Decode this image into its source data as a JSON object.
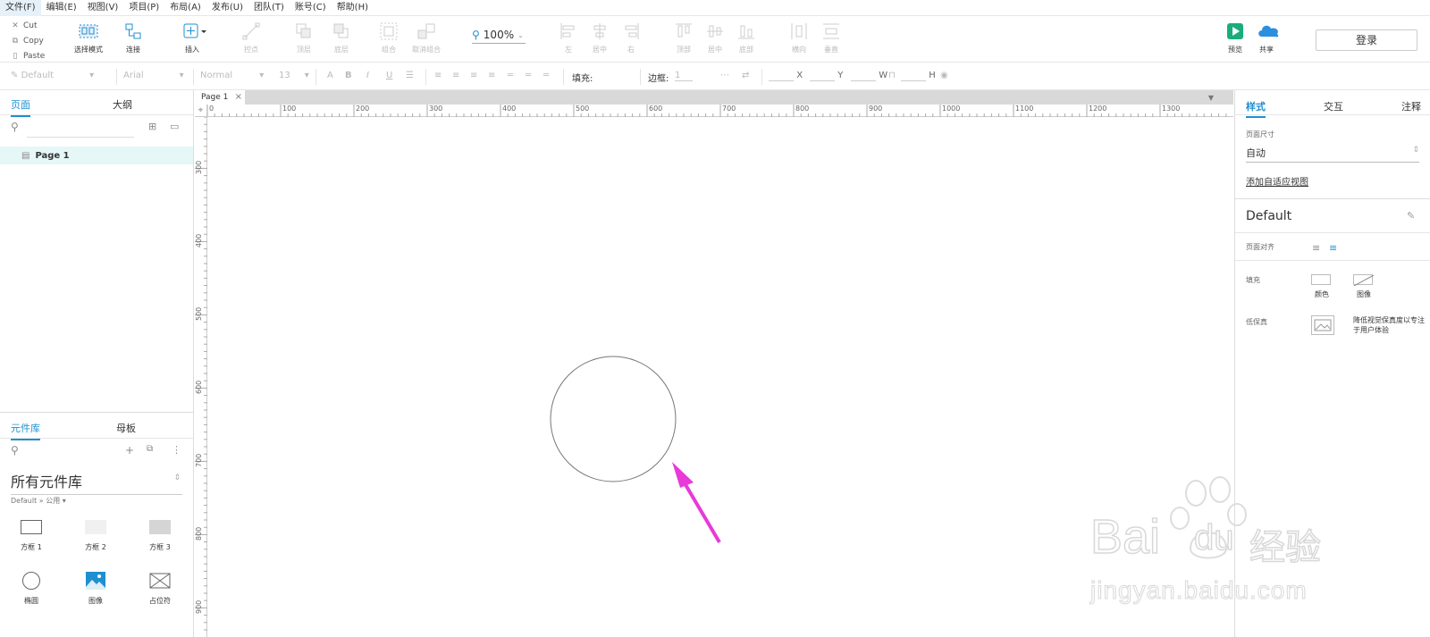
{
  "menubar": {
    "items": [
      "文件(F)",
      "编辑(E)",
      "视图(V)",
      "项目(P)",
      "布局(A)",
      "发布(U)",
      "团队(T)",
      "账号(C)",
      "帮助(H)"
    ]
  },
  "toolbar": {
    "cut": "Cut",
    "copy": "Copy",
    "paste": "Paste",
    "select_mode": "选择模式",
    "connect": "连接",
    "insert": "插入",
    "point": "控点",
    "top_layer": "顶层",
    "bottom_layer": "底层",
    "group": "组合",
    "ungroup": "取消组合",
    "zoom": "100%",
    "align_left": "左",
    "align_center": "居中",
    "align_right": "右",
    "align_top": "顶部",
    "align_middle": "居中",
    "align_bottom": "底部",
    "dist_h": "横向",
    "dist_v": "垂直",
    "preview": "预览",
    "share": "共享",
    "login": "登录"
  },
  "formatbar": {
    "style": "Default",
    "font": "Arial",
    "weight": "Normal",
    "size": "13",
    "fill_label": "填充:",
    "border_label": "边框:",
    "border_value": "1",
    "x": "X",
    "y": "Y",
    "w": "W",
    "h": "H"
  },
  "left_panel": {
    "tab_pages": "页面",
    "tab_outline": "大纲",
    "page_name": "Page 1",
    "tab_library": "元件库",
    "tab_masters": "母板",
    "library_title": "所有元件库",
    "library_sub": "Default » 公用 ▾",
    "widgets": [
      "方框 1",
      "方框 2",
      "方框 3",
      "椭圆",
      "图像",
      "占位符"
    ]
  },
  "canvas": {
    "doc_tab": "Page 1",
    "ruler_h": [
      "0",
      "100",
      "200",
      "300",
      "400",
      "500",
      "600",
      "700",
      "800",
      "900",
      "1000",
      "1100",
      "1200",
      "1300"
    ],
    "ruler_v": [
      "300",
      "400",
      "500",
      "600",
      "700",
      "800",
      "900"
    ]
  },
  "right_panel": {
    "tab_style": "样式",
    "tab_interact": "交互",
    "tab_notes": "注释",
    "page_size_label": "页面尺寸",
    "page_size_value": "自动",
    "add_adaptive": "添加自适应视图",
    "style_name": "Default",
    "page_align_label": "页面对齐",
    "fill_label": "填充",
    "fill_color": "颜色",
    "fill_image": "图像",
    "low_fi_label": "低保真",
    "low_fi_desc": "降低视觉保真度以专注于用户体验"
  },
  "watermark": {
    "brand": "Bai",
    "brand_du": "du",
    "brand_cn": "经验",
    "url": "jingyan.baidu.com"
  },
  "colors": {
    "accent": "#1f8fd0",
    "annotation_arrow": "#e83ad8",
    "preview_green": "#1aad7a",
    "share_blue": "#2b8fe0"
  }
}
